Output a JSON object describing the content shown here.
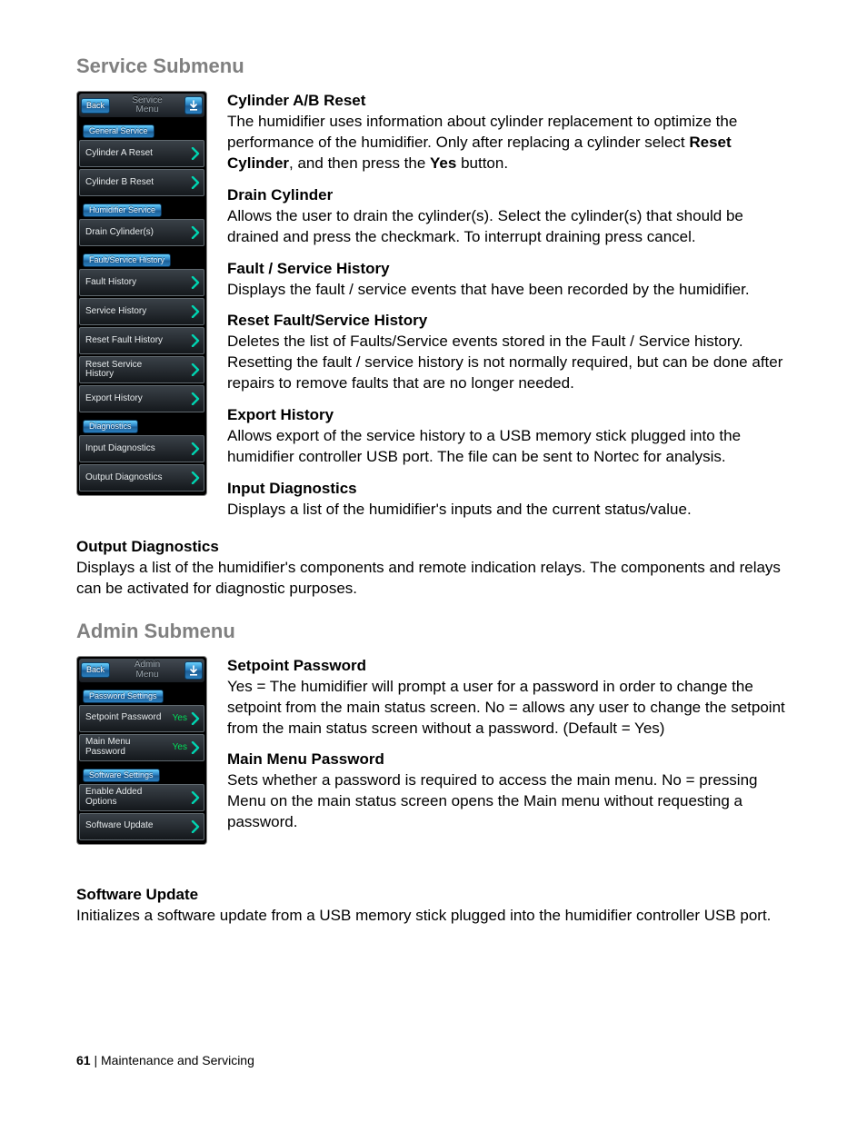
{
  "footer": {
    "page": "61",
    "separator": " | ",
    "label": "Maintenance and Servicing"
  },
  "service": {
    "heading": "Service  Submenu",
    "panel": {
      "back": "Back",
      "title1": "Service",
      "title2": "Menu",
      "groups": [
        {
          "label": "General Service",
          "items": [
            {
              "label": "Cylinder A Reset"
            },
            {
              "label": "Cylinder B Reset"
            }
          ]
        },
        {
          "label": "Humidifier Service",
          "items": [
            {
              "label": "Drain Cylinder(s)"
            }
          ]
        },
        {
          "label": "Fault/Service History",
          "items": [
            {
              "label": "Fault History"
            },
            {
              "label": "Service History"
            },
            {
              "label": "Reset Fault History"
            },
            {
              "label": "Reset Service History"
            },
            {
              "label": "Export History"
            }
          ]
        },
        {
          "label": "Diagnostics",
          "items": [
            {
              "label": "Input Diagnostics"
            },
            {
              "label": "Output Diagnostics"
            }
          ]
        }
      ]
    },
    "items": [
      {
        "title": "Cylinder A/B Reset",
        "body_pre": "The humidifier uses information about cylinder replacement to optimize the performance of the humidifier.  Only after replacing a cylinder select ",
        "bold1": "Reset Cylinder",
        "body_mid": ", and then press the ",
        "bold2": "Yes",
        "body_post": " button."
      },
      {
        "title": "Drain Cylinder",
        "body": "Allows the user to drain the cylinder(s).  Select the cylinder(s) that should be drained and press the checkmark.  To interrupt draining press cancel."
      },
      {
        "title": "Fault / Service History",
        "body": "Displays the fault / service events that have been recorded by the humidifier."
      },
      {
        "title": "Reset Fault/Service History",
        "body": "Deletes the list of Faults/Service events stored in the Fault / Service history.  Resetting the fault / service history is not normally required, but can be done after repairs to remove faults that are no longer needed."
      },
      {
        "title": "Export History",
        "body": "Allows export of the service history to a USB memory stick plugged into the humidifier controller USB port.  The file can be sent to Nortec for analysis."
      },
      {
        "title": "Input Diagnostics",
        "body": "Displays a list of the humidifier's inputs and the current status/value."
      }
    ],
    "overflow": {
      "title": "Output Diagnostics",
      "body": "Displays a list of the humidifier's components and remote indication relays.  The components and relays can be activated for diagnostic purposes."
    }
  },
  "admin": {
    "heading": "Admin Submenu",
    "panel": {
      "back": "Back",
      "title1": "Admin",
      "title2": "Menu",
      "groups": [
        {
          "label": "Password Settings",
          "items": [
            {
              "label": "Setpoint Password",
              "value": "Yes"
            },
            {
              "label": "Main Menu Password",
              "value": "Yes"
            }
          ]
        },
        {
          "label": "Software Settings",
          "items": [
            {
              "label": "Enable Added Options"
            },
            {
              "label": "Software Update"
            }
          ]
        }
      ]
    },
    "items": [
      {
        "title": "Setpoint Password",
        "body": "Yes = The humidifier will prompt a user for a password in order to change the setpoint from the main status screen.  No = allows any user to change the setpoint from the main status screen without a password. (Default = Yes)"
      },
      {
        "title": "Main Menu Password",
        "body": "Sets whether a password is required to access the main menu.  No = pressing Menu on the main status screen opens the Main menu without requesting a password."
      }
    ],
    "overflow": {
      "title": "Software Update",
      "body": "Initializes a software update from a USB memory stick plugged into the humidifier controller USB port."
    }
  }
}
